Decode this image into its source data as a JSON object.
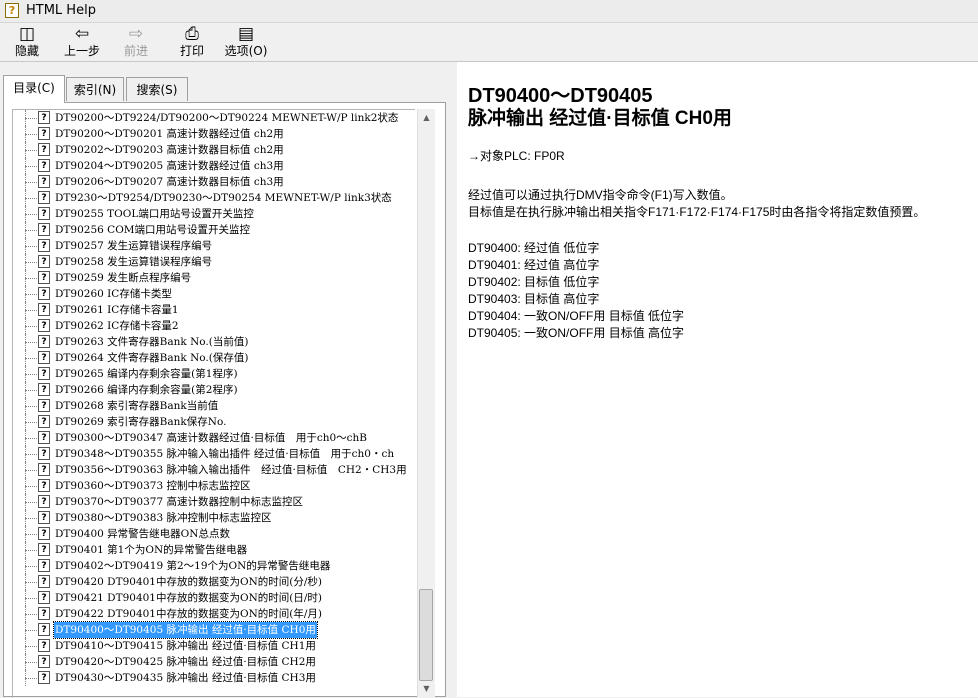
{
  "window": {
    "title": "HTML Help"
  },
  "toolbar": {
    "hide": "隐藏",
    "back": "上一步",
    "forward": "前进",
    "print": "打印",
    "options": "选项(O)"
  },
  "tabs": {
    "contents": "目录(C)",
    "index": "索引(N)",
    "search": "搜索(S)"
  },
  "tree": {
    "items": [
      "DT90200～DT9224/DT90200～DT90224 MEWNET-W/P link2状态",
      "DT90200～DT90201 高速计数器经过值 ch2用",
      "DT90202～DT90203 高速计数器目标值 ch2用",
      "DT90204～DT90205 高速计数器经过值 ch3用",
      "DT90206～DT90207 高速计数器目标值 ch3用",
      "DT9230～DT9254/DT90230～DT90254 MEWNET-W/P link3状态",
      "DT90255 TOOL端口用站号设置开关监控",
      "DT90256 COM端口用站号设置开关监控",
      "DT90257 发生运算错误程序编号",
      "DT90258 发生运算错误程序编号",
      "DT90259 发生断点程序编号",
      "DT90260 IC存储卡类型",
      "DT90261 IC存储卡容量1",
      "DT90262 IC存储卡容量2",
      "DT90263 文件寄存器Bank No.(当前值)",
      "DT90264 文件寄存器Bank No.(保存值)",
      "DT90265 编译内存剩余容量(第1程序)",
      "DT90266 编译内存剩余容量(第2程序)",
      "DT90268 索引寄存器Bank当前值",
      "DT90269 索引寄存器Bank保存No.",
      "DT90300～DT90347 高速计数器经过值·目标值　用于ch0～chB",
      "DT90348～DT90355 脉冲输入输出插件 经过值·目标值　用于ch0・ch",
      "DT90356～DT90363 脉冲输入输出插件　经过值·目标值　CH2・CH3用",
      "DT90360～DT90373 控制中标志监控区",
      "DT90370～DT90377 高速计数器控制中标志监控区",
      "DT90380～DT90383 脉冲控制中标志监控区",
      "DT90400 异常警告继电器ON总点数",
      "DT90401 第1个为ON的异常警告继电器",
      "DT90402～DT90419 第2～19个为ON的异常警告继电器",
      "DT90420 DT90401中存放的数据变为ON的时间(分/秒)",
      "DT90421 DT90401中存放的数据变为ON的时间(日/时)",
      "DT90422 DT90401中存放的数据变为ON的时间(年/月)",
      "DT90400～DT90405 脉冲输出 经过值·目标值 CH0用",
      "DT90410～DT90415 脉冲输出 经过值·目标值 CH1用",
      "DT90420～DT90425 脉冲输出 经过值·目标值 CH2用",
      "DT90430～DT90435 脉冲输出 经过值·目标值 CH3用"
    ],
    "selected_index": 32
  },
  "content": {
    "title_line1": "DT90400～DT90405",
    "title_line2": "脉冲输出 经过值·目标值 CH0用",
    "target_plc": "→对象PLC: FP0R",
    "desc1": "经过值可以通过执行DMV指令命令(F1)写入数值。",
    "desc2": "目标值是在执行脉冲输出相关指令F171·F172·F174·F175时由各指令将指定数值预置。",
    "table": [
      "DT90400:  经过值  低位字",
      "DT90401:  经过值  高位字",
      "DT90402:  目标值  低位字",
      "DT90403:  目标值  高位字",
      "DT90404:  一致ON/OFF用 目标值  低位字",
      "DT90405:  一致ON/OFF用 目标值  高位字"
    ]
  }
}
